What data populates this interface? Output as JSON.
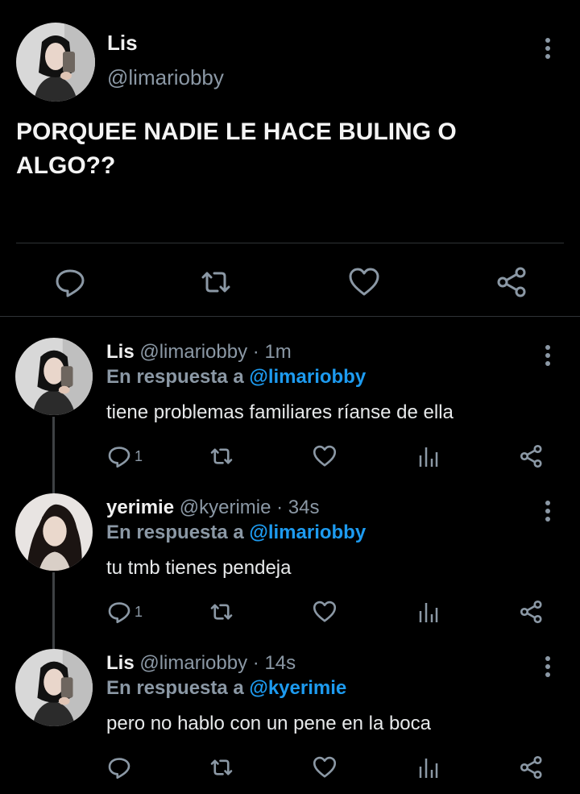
{
  "theme": {
    "background": "#000000",
    "text": "#e7e9ea",
    "secondary": "#8b98a5",
    "link": "#1d9bf0",
    "divider": "#2f3336"
  },
  "main_tweet": {
    "author_name": "Lis",
    "author_handle": "@limariobby",
    "text": "PORQUEE NADIE LE HACE BULING O ALGO??",
    "actions": [
      "reply-icon",
      "retweet-icon",
      "like-icon",
      "share-icon"
    ]
  },
  "replies": [
    {
      "name": "Lis",
      "handle": "@limariobby",
      "separator": "·",
      "time": "1m",
      "reply_prefix": "En respuesta a",
      "reply_to": "@limariobby",
      "text": "tiene problemas familiares ríanse de ella",
      "reply_count": "1"
    },
    {
      "name": "yerimie",
      "handle": "@kyerimie",
      "separator": "·",
      "time": "34s",
      "reply_prefix": "En respuesta a",
      "reply_to": "@limariobby",
      "text": "tu tmb tienes pendeja",
      "reply_count": "1"
    },
    {
      "name": "Lis",
      "handle": "@limariobby",
      "separator": "·",
      "time": "14s",
      "reply_prefix": "En respuesta a",
      "reply_to": "@kyerimie",
      "text": "pero no hablo con un pene en la boca",
      "reply_count": ""
    }
  ]
}
